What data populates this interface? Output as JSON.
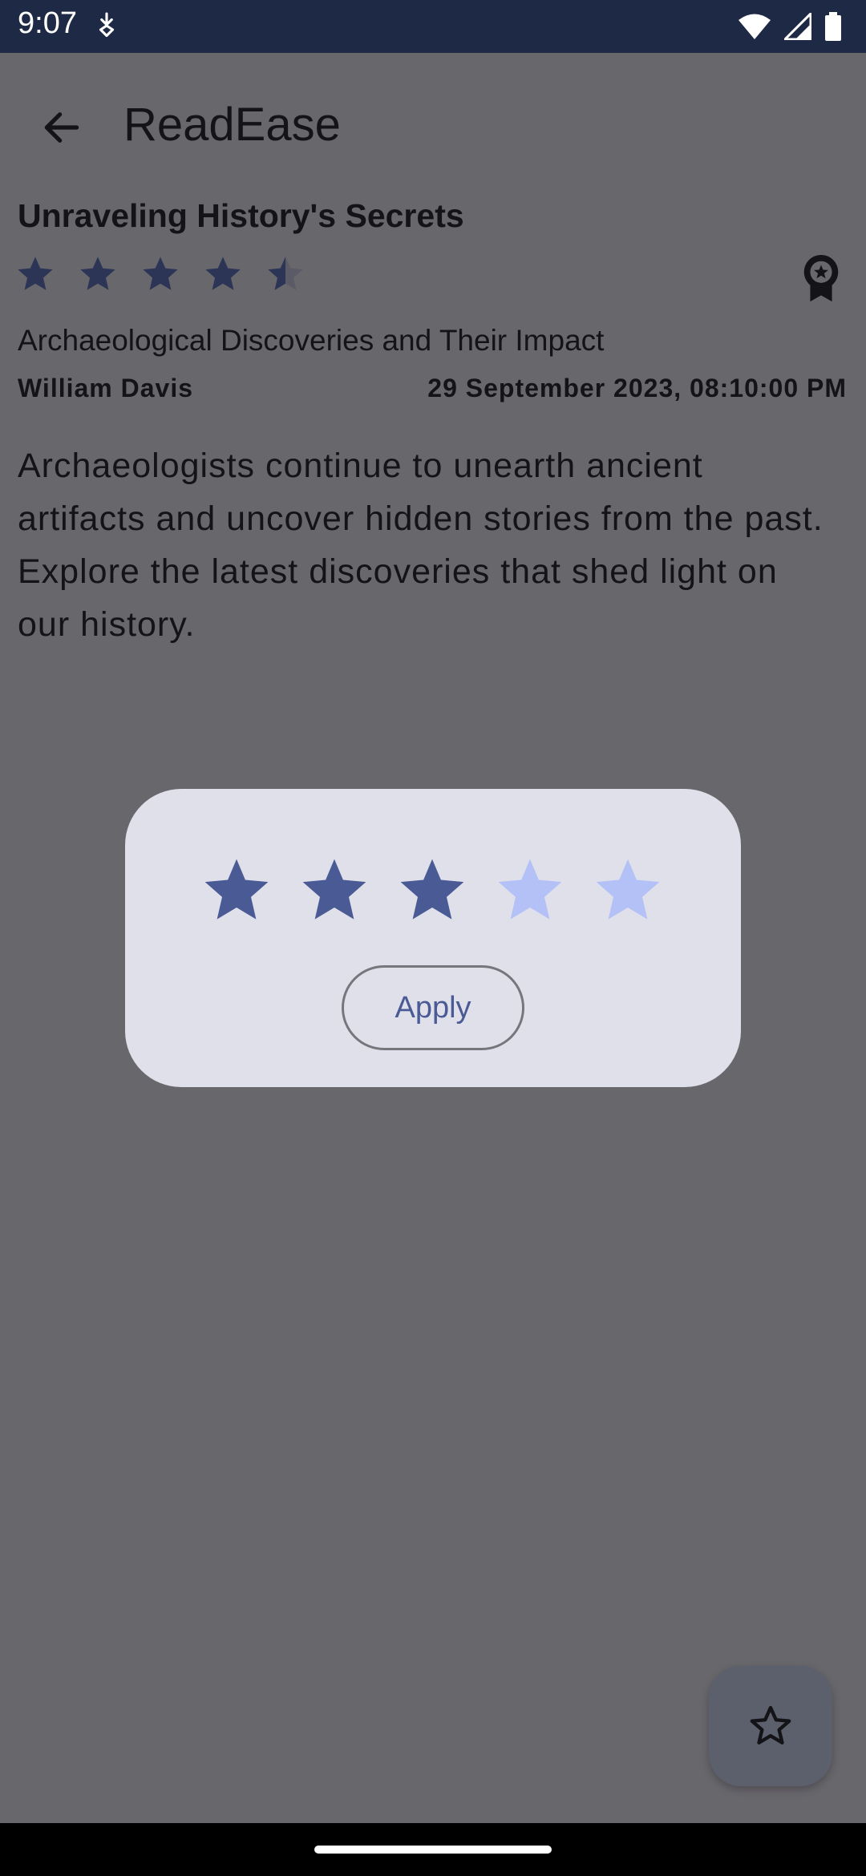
{
  "status_bar": {
    "time": "9:07"
  },
  "app_bar": {
    "title": "ReadEase"
  },
  "article": {
    "title": "Unraveling History's Secrets",
    "rating": 4.5,
    "rating_max": 5,
    "subtitle": "Archaeological Discoveries and Their Impact",
    "author": "William Davis",
    "date": "29 September 2023, 08:10:00 PM",
    "body": "Archaeologists continue to unearth ancient artifacts and uncover hidden stories from the past. Explore the latest discoveries that shed light on our history."
  },
  "rating_dialog": {
    "selected": 3,
    "max": 5,
    "apply_label": "Apply"
  },
  "colors": {
    "scrim_background": "#68676c",
    "status_bar": "#1e2a45",
    "star_filled_dialog": "#4a5a94",
    "star_empty_dialog": "#b3c1f6",
    "article_star": "#2c3556",
    "dialog_surface": "#e0e0eb",
    "fab": "#5c5f6c"
  },
  "icons": {
    "back": "arrow-back-icon",
    "badge": "award-badge-icon",
    "fab": "star-outline-icon",
    "rating_star": "star-icon"
  }
}
